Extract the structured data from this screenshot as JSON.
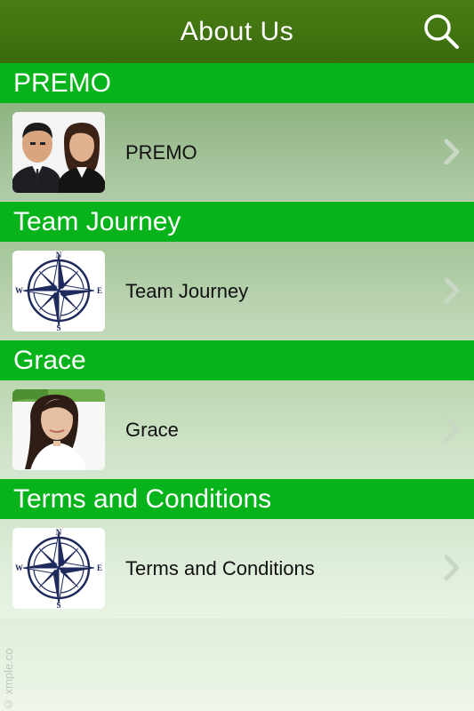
{
  "header": {
    "title": "About Us",
    "search_icon": "search-icon"
  },
  "sections": [
    {
      "header": "PREMO",
      "item_label": "PREMO",
      "thumb": "people-photo"
    },
    {
      "header": "Team Journey",
      "item_label": "Team Journey",
      "thumb": "compass-rose"
    },
    {
      "header": "Grace",
      "item_label": "Grace",
      "thumb": "portrait-photo"
    },
    {
      "header": "Terms and Conditions",
      "item_label": "Terms and Conditions",
      "thumb": "compass-rose"
    }
  ],
  "watermark": "© xmple.co",
  "colors": {
    "topbar": "#3f7010",
    "section_header": "#07b31a",
    "chevron": "#c8d8c4"
  }
}
